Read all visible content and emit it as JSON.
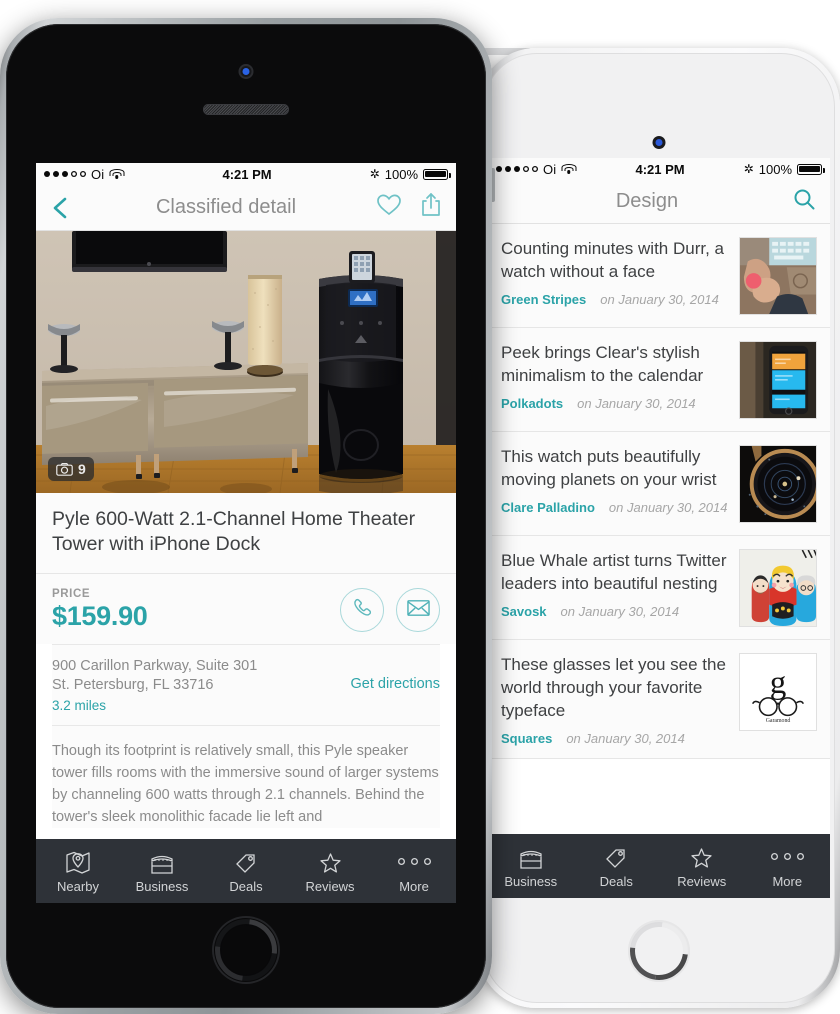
{
  "status_bar": {
    "carrier": "Oi",
    "signal_filled": 3,
    "signal_total": 5,
    "time": "4:21 PM",
    "battery_text": "100%",
    "bluetooth_icon": "bluetooth-icon",
    "wifi_icon": "wifi-icon"
  },
  "accent_color": "#2ba3a8",
  "tabbar_color": "#2e3238",
  "left_phone": {
    "device": "iphone-5s-space-gray",
    "app": {
      "navbar": {
        "back_icon": "chevron-left-icon",
        "title": "Classified detail",
        "favorite_icon": "heart-icon",
        "share_icon": "share-icon"
      },
      "hero": {
        "photo_count": "9",
        "camera_icon": "camera-icon",
        "alt": "Home theater speaker tower beside a credenza with TV and lamp"
      },
      "listing": {
        "title": "Pyle 600-Watt 2.1-Channel Home Theater Tower with iPhone Dock",
        "price_label": "PRICE",
        "price_value": "$159.90",
        "call_icon": "phone-icon",
        "email_icon": "envelope-icon",
        "address_line1": "900 Carillon Parkway, Suite 301",
        "address_line2": "St. Petersburg, FL 33716",
        "distance": "3.2 miles",
        "directions_link": "Get directions",
        "description": "Though its footprint is relatively small, this Pyle speaker tower fills rooms with the immersive sound of larger systems by channeling 600 watts through 2.1 channels. Behind the tower's sleek monolithic facade lie left and"
      },
      "tabs": [
        {
          "label": "Nearby",
          "icon": "map-pin-icon"
        },
        {
          "label": "Business",
          "icon": "storefront-icon"
        },
        {
          "label": "Deals",
          "icon": "tag-icon"
        },
        {
          "label": "Reviews",
          "icon": "star-icon"
        },
        {
          "label": "More",
          "icon": "ellipsis-icon"
        }
      ]
    }
  },
  "right_phone": {
    "device": "iphone-5s-silver",
    "app": {
      "navbar": {
        "title": "Design",
        "search_icon": "search-icon"
      },
      "articles": [
        {
          "title": "Counting minutes with Durr, a watch without a face",
          "author": "Green Stripes",
          "date": "on January 30, 2014",
          "thumb": "hands-keyboard-thumb"
        },
        {
          "title": "Peek brings Clear's stylish minimalism to the calendar",
          "author": "Polkadots",
          "date": "on January 30, 2014",
          "thumb": "phone-app-thumb"
        },
        {
          "title": "This watch puts beautifully moving planets on your wrist",
          "author": "Clare Palladino",
          "date": "on January 30, 2014",
          "thumb": "watch-thumb"
        },
        {
          "title": "Blue Whale artist turns Twitter leaders into beautiful nesting",
          "author": "Savosk",
          "date": "on January 30, 2014",
          "thumb": "matryoshka-thumb"
        },
        {
          "title": "These glasses let you see the world through your favorite typeface",
          "author": "Squares",
          "date": "on January 30, 2014",
          "thumb": "garamond-glasses-thumb"
        }
      ],
      "tabs": [
        {
          "label": "Business",
          "icon": "storefront-icon"
        },
        {
          "label": "Deals",
          "icon": "tag-icon"
        },
        {
          "label": "Reviews",
          "icon": "star-icon"
        },
        {
          "label": "More",
          "icon": "ellipsis-icon"
        }
      ]
    }
  }
}
